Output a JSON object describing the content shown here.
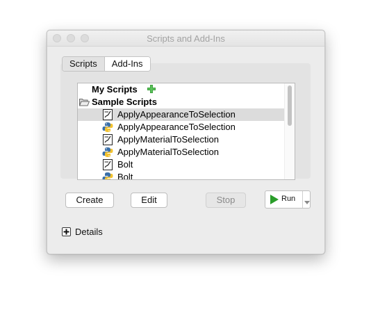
{
  "window": {
    "title": "Scripts and Add-Ins"
  },
  "tabs": [
    {
      "label": "Scripts",
      "selected": true
    },
    {
      "label": "Add-Ins",
      "selected": false
    }
  ],
  "list": {
    "groups": [
      {
        "label": "My Scripts",
        "icon": "add-icon"
      },
      {
        "label": "Sample Scripts",
        "icon": "folder-open-icon"
      }
    ],
    "items": [
      {
        "label": "ApplyAppearanceToSelection",
        "icon": "script-file-icon",
        "selected": true
      },
      {
        "label": "ApplyAppearanceToSelection",
        "icon": "python-icon",
        "selected": false
      },
      {
        "label": "ApplyMaterialToSelection",
        "icon": "script-file-icon",
        "selected": false
      },
      {
        "label": "ApplyMaterialToSelection",
        "icon": "python-icon",
        "selected": false
      },
      {
        "label": "Bolt",
        "icon": "script-file-icon",
        "selected": false
      },
      {
        "label": "Bolt",
        "icon": "python-icon",
        "selected": false
      }
    ]
  },
  "buttons": {
    "create": "Create",
    "edit": "Edit",
    "stop": "Stop",
    "run": "Run"
  },
  "details": {
    "label": "Details"
  },
  "colors": {
    "run_green": "#2a9d2a",
    "add_green": "#3a9a3a",
    "selection": "#dcdcdc"
  }
}
